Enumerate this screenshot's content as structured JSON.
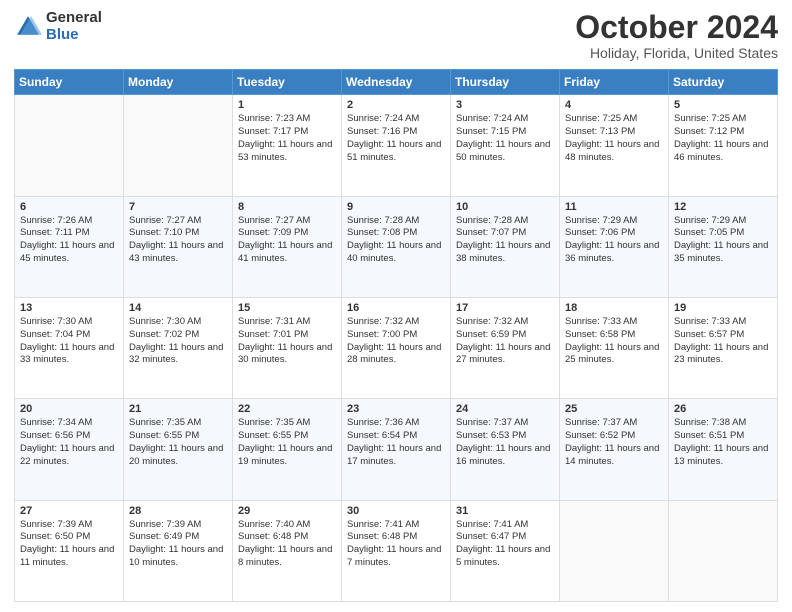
{
  "logo": {
    "general": "General",
    "blue": "Blue"
  },
  "header": {
    "title": "October 2024",
    "subtitle": "Holiday, Florida, United States"
  },
  "weekdays": [
    "Sunday",
    "Monday",
    "Tuesday",
    "Wednesday",
    "Thursday",
    "Friday",
    "Saturday"
  ],
  "weeks": [
    [
      {
        "day": "",
        "sunrise": "",
        "sunset": "",
        "daylight": ""
      },
      {
        "day": "",
        "sunrise": "",
        "sunset": "",
        "daylight": ""
      },
      {
        "day": "1",
        "sunrise": "Sunrise: 7:23 AM",
        "sunset": "Sunset: 7:17 PM",
        "daylight": "Daylight: 11 hours and 53 minutes."
      },
      {
        "day": "2",
        "sunrise": "Sunrise: 7:24 AM",
        "sunset": "Sunset: 7:16 PM",
        "daylight": "Daylight: 11 hours and 51 minutes."
      },
      {
        "day": "3",
        "sunrise": "Sunrise: 7:24 AM",
        "sunset": "Sunset: 7:15 PM",
        "daylight": "Daylight: 11 hours and 50 minutes."
      },
      {
        "day": "4",
        "sunrise": "Sunrise: 7:25 AM",
        "sunset": "Sunset: 7:13 PM",
        "daylight": "Daylight: 11 hours and 48 minutes."
      },
      {
        "day": "5",
        "sunrise": "Sunrise: 7:25 AM",
        "sunset": "Sunset: 7:12 PM",
        "daylight": "Daylight: 11 hours and 46 minutes."
      }
    ],
    [
      {
        "day": "6",
        "sunrise": "Sunrise: 7:26 AM",
        "sunset": "Sunset: 7:11 PM",
        "daylight": "Daylight: 11 hours and 45 minutes."
      },
      {
        "day": "7",
        "sunrise": "Sunrise: 7:27 AM",
        "sunset": "Sunset: 7:10 PM",
        "daylight": "Daylight: 11 hours and 43 minutes."
      },
      {
        "day": "8",
        "sunrise": "Sunrise: 7:27 AM",
        "sunset": "Sunset: 7:09 PM",
        "daylight": "Daylight: 11 hours and 41 minutes."
      },
      {
        "day": "9",
        "sunrise": "Sunrise: 7:28 AM",
        "sunset": "Sunset: 7:08 PM",
        "daylight": "Daylight: 11 hours and 40 minutes."
      },
      {
        "day": "10",
        "sunrise": "Sunrise: 7:28 AM",
        "sunset": "Sunset: 7:07 PM",
        "daylight": "Daylight: 11 hours and 38 minutes."
      },
      {
        "day": "11",
        "sunrise": "Sunrise: 7:29 AM",
        "sunset": "Sunset: 7:06 PM",
        "daylight": "Daylight: 11 hours and 36 minutes."
      },
      {
        "day": "12",
        "sunrise": "Sunrise: 7:29 AM",
        "sunset": "Sunset: 7:05 PM",
        "daylight": "Daylight: 11 hours and 35 minutes."
      }
    ],
    [
      {
        "day": "13",
        "sunrise": "Sunrise: 7:30 AM",
        "sunset": "Sunset: 7:04 PM",
        "daylight": "Daylight: 11 hours and 33 minutes."
      },
      {
        "day": "14",
        "sunrise": "Sunrise: 7:30 AM",
        "sunset": "Sunset: 7:02 PM",
        "daylight": "Daylight: 11 hours and 32 minutes."
      },
      {
        "day": "15",
        "sunrise": "Sunrise: 7:31 AM",
        "sunset": "Sunset: 7:01 PM",
        "daylight": "Daylight: 11 hours and 30 minutes."
      },
      {
        "day": "16",
        "sunrise": "Sunrise: 7:32 AM",
        "sunset": "Sunset: 7:00 PM",
        "daylight": "Daylight: 11 hours and 28 minutes."
      },
      {
        "day": "17",
        "sunrise": "Sunrise: 7:32 AM",
        "sunset": "Sunset: 6:59 PM",
        "daylight": "Daylight: 11 hours and 27 minutes."
      },
      {
        "day": "18",
        "sunrise": "Sunrise: 7:33 AM",
        "sunset": "Sunset: 6:58 PM",
        "daylight": "Daylight: 11 hours and 25 minutes."
      },
      {
        "day": "19",
        "sunrise": "Sunrise: 7:33 AM",
        "sunset": "Sunset: 6:57 PM",
        "daylight": "Daylight: 11 hours and 23 minutes."
      }
    ],
    [
      {
        "day": "20",
        "sunrise": "Sunrise: 7:34 AM",
        "sunset": "Sunset: 6:56 PM",
        "daylight": "Daylight: 11 hours and 22 minutes."
      },
      {
        "day": "21",
        "sunrise": "Sunrise: 7:35 AM",
        "sunset": "Sunset: 6:55 PM",
        "daylight": "Daylight: 11 hours and 20 minutes."
      },
      {
        "day": "22",
        "sunrise": "Sunrise: 7:35 AM",
        "sunset": "Sunset: 6:55 PM",
        "daylight": "Daylight: 11 hours and 19 minutes."
      },
      {
        "day": "23",
        "sunrise": "Sunrise: 7:36 AM",
        "sunset": "Sunset: 6:54 PM",
        "daylight": "Daylight: 11 hours and 17 minutes."
      },
      {
        "day": "24",
        "sunrise": "Sunrise: 7:37 AM",
        "sunset": "Sunset: 6:53 PM",
        "daylight": "Daylight: 11 hours and 16 minutes."
      },
      {
        "day": "25",
        "sunrise": "Sunrise: 7:37 AM",
        "sunset": "Sunset: 6:52 PM",
        "daylight": "Daylight: 11 hours and 14 minutes."
      },
      {
        "day": "26",
        "sunrise": "Sunrise: 7:38 AM",
        "sunset": "Sunset: 6:51 PM",
        "daylight": "Daylight: 11 hours and 13 minutes."
      }
    ],
    [
      {
        "day": "27",
        "sunrise": "Sunrise: 7:39 AM",
        "sunset": "Sunset: 6:50 PM",
        "daylight": "Daylight: 11 hours and 11 minutes."
      },
      {
        "day": "28",
        "sunrise": "Sunrise: 7:39 AM",
        "sunset": "Sunset: 6:49 PM",
        "daylight": "Daylight: 11 hours and 10 minutes."
      },
      {
        "day": "29",
        "sunrise": "Sunrise: 7:40 AM",
        "sunset": "Sunset: 6:48 PM",
        "daylight": "Daylight: 11 hours and 8 minutes."
      },
      {
        "day": "30",
        "sunrise": "Sunrise: 7:41 AM",
        "sunset": "Sunset: 6:48 PM",
        "daylight": "Daylight: 11 hours and 7 minutes."
      },
      {
        "day": "31",
        "sunrise": "Sunrise: 7:41 AM",
        "sunset": "Sunset: 6:47 PM",
        "daylight": "Daylight: 11 hours and 5 minutes."
      },
      {
        "day": "",
        "sunrise": "",
        "sunset": "",
        "daylight": ""
      },
      {
        "day": "",
        "sunrise": "",
        "sunset": "",
        "daylight": ""
      }
    ]
  ]
}
